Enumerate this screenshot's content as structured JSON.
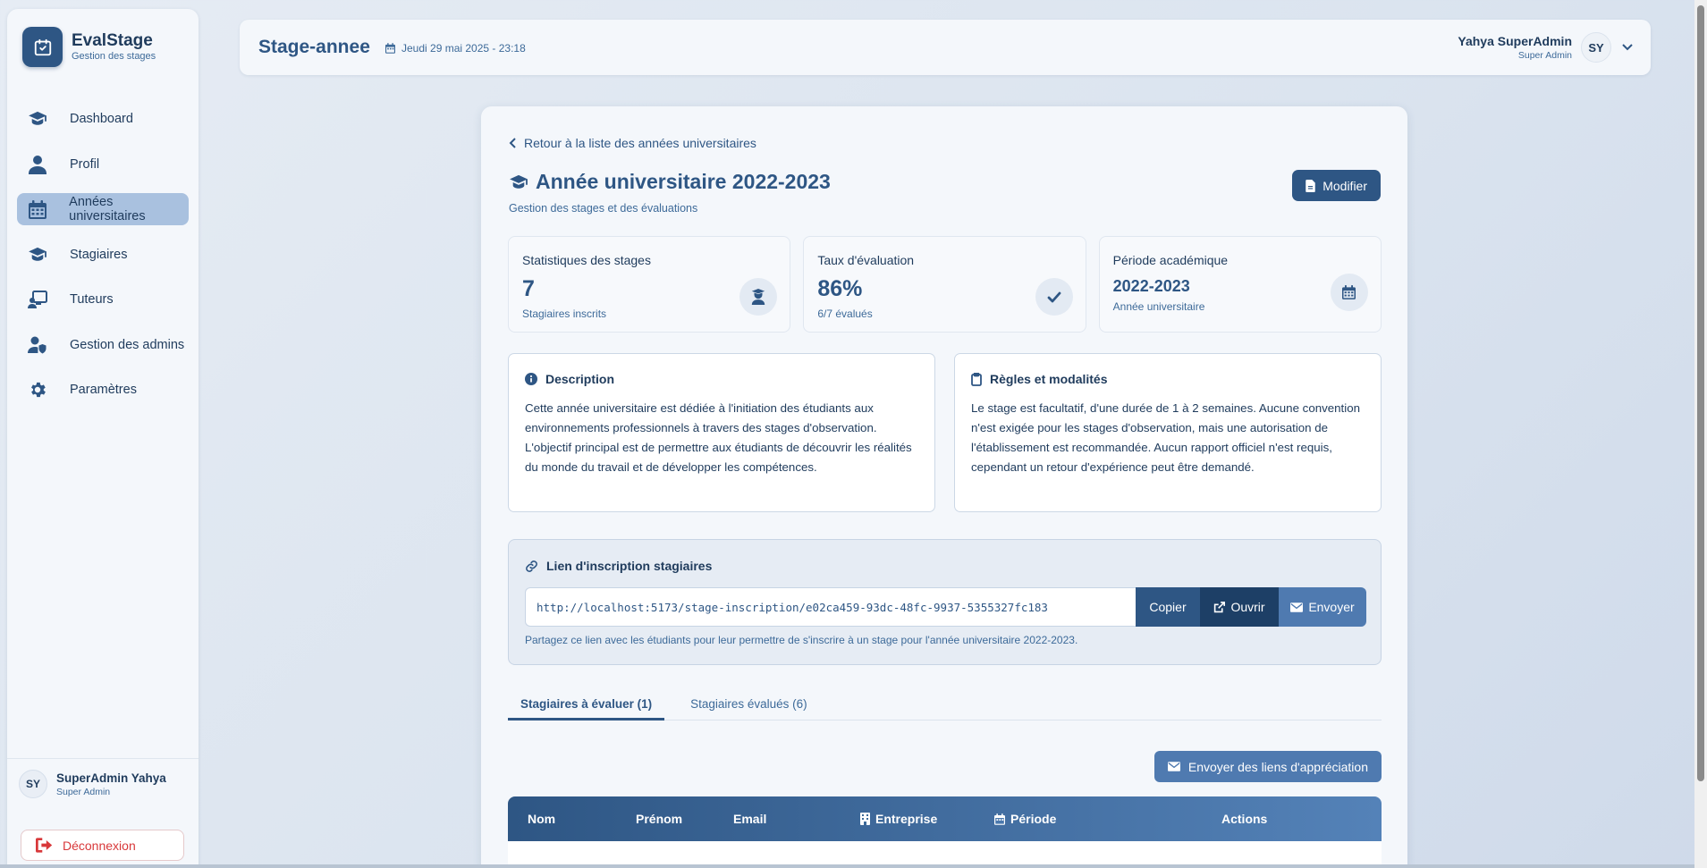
{
  "brand": {
    "name": "EvalStage",
    "subtitle": "Gestion des stages"
  },
  "sidebar": {
    "items": [
      {
        "label": "Dashboard",
        "icon": "graduation-cap-icon",
        "active": false
      },
      {
        "label": "Profil",
        "icon": "user-icon",
        "active": false
      },
      {
        "label": "Années universitaires",
        "icon": "calendar-icon",
        "active": true
      },
      {
        "label": "Stagiaires",
        "icon": "graduation-cap-icon",
        "active": false
      },
      {
        "label": "Tuteurs",
        "icon": "chalkboard-teacher-icon",
        "active": false
      },
      {
        "label": "Gestion des admins",
        "icon": "user-shield-icon",
        "active": false
      },
      {
        "label": "Paramètres",
        "icon": "gear-icon",
        "active": false
      }
    ],
    "user": {
      "initials": "SY",
      "name": "SuperAdmin Yahya",
      "role": "Super Admin"
    },
    "logout_label": "Déconnexion"
  },
  "header": {
    "title": "Stage-annee",
    "date": "Jeudi 29 mai 2025 - 23:18",
    "user": {
      "name": "Yahya SuperAdmin",
      "role": "Super Admin",
      "initials": "SY"
    }
  },
  "main": {
    "back_label": "Retour à la liste des années universitaires",
    "title": "Année universitaire 2022-2023",
    "subtitle": "Gestion des stages et des évaluations",
    "modify_label": "Modifier",
    "stats": [
      {
        "label": "Statistiques des stages",
        "value": "7",
        "sub": "Stagiaires inscrits"
      },
      {
        "label": "Taux d'évaluation",
        "value": "86%",
        "sub": "6/7 évalués"
      },
      {
        "label": "Période académique",
        "value": "2022-2023",
        "sub": "Année universitaire"
      }
    ],
    "description": {
      "title": "Description",
      "text": "Cette année universitaire est dédiée à l'initiation des étudiants aux environnements professionnels à travers des stages d'observation. L'objectif principal est de permettre aux étudiants de découvrir les réalités du monde du travail et de développer les compétences."
    },
    "rules": {
      "title": "Règles et modalités",
      "text": "Le stage est facultatif, d'une durée de 1 à 2 semaines. Aucune convention n'est exigée pour les stages d'observation, mais une autorisation de l'établissement est recommandée. Aucun rapport officiel n'est requis, cependant un retour d'expérience peut être demandé."
    },
    "link": {
      "title": "Lien d'inscription stagiaires",
      "url": "http://localhost:5173/stage-inscription/e02ca459-93dc-48fc-9937-5355327fc183",
      "copy_label": "Copier",
      "open_label": "Ouvrir",
      "send_label": "Envoyer",
      "help": "Partagez ce lien avec les étudiants pour leur permettre de s'inscrire à un stage pour l'année universitaire 2022-2023."
    },
    "tabs": [
      {
        "label": "Stagiaires à évaluer (1)",
        "active": true
      },
      {
        "label": "Stagiaires évalués (6)",
        "active": false
      }
    ],
    "appreciation_label": "Envoyer des liens d'appréciation",
    "table": {
      "columns": [
        "Nom",
        "Prénom",
        "Email",
        "Entreprise",
        "Période",
        "Actions"
      ]
    }
  }
}
